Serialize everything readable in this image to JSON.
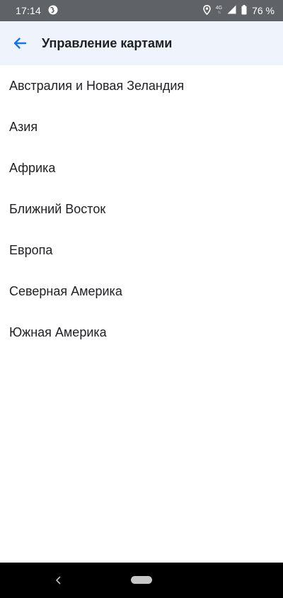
{
  "status_bar": {
    "time": "17:14",
    "network": "4G",
    "battery_percent": "76 %"
  },
  "app_bar": {
    "title": "Управление картами",
    "back_icon": "arrow-left-icon",
    "accent_color": "#1a73e8"
  },
  "regions": [
    {
      "label": "Австралия и Новая Зеландия"
    },
    {
      "label": "Азия"
    },
    {
      "label": "Африка"
    },
    {
      "label": "Ближний Восток"
    },
    {
      "label": "Европа"
    },
    {
      "label": "Северная Америка"
    },
    {
      "label": "Южная Америка"
    }
  ],
  "nav_bar": {
    "back_icon": "chevron-left-icon",
    "home_icon": "home-pill-icon"
  }
}
